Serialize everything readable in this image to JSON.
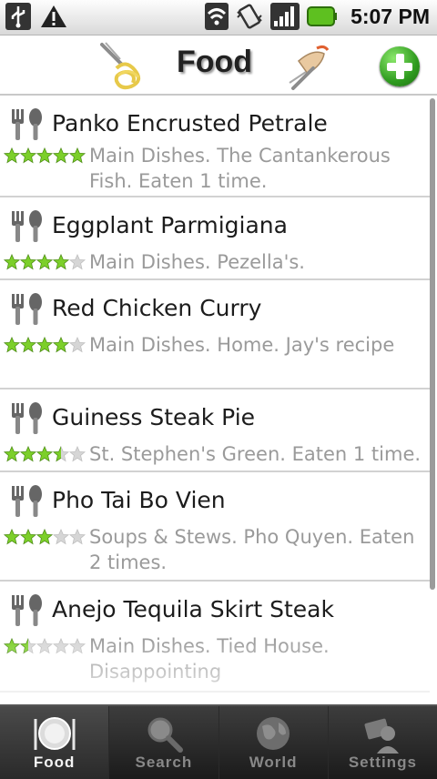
{
  "status_bar": {
    "time": "5:07 PM",
    "icons": [
      "usb-icon",
      "warning-icon",
      "wifi-icon",
      "vibrate-icon",
      "signal-icon",
      "battery-icon"
    ],
    "battery_color": "#5ec020"
  },
  "header": {
    "title": "Food",
    "add_icon": "plus-icon",
    "accent": "#2f9b1f"
  },
  "list": {
    "items": [
      {
        "title": "Panko Encrusted Petrale",
        "rating": 5,
        "description": "Main Dishes. The Cantankerous Fish. Eaten 1 time.",
        "icon": "fork-spoon-icon"
      },
      {
        "title": "Eggplant Parmigiana",
        "rating": 4,
        "description": "Main Dishes. Pezella's.",
        "icon": "fork-spoon-icon"
      },
      {
        "title": "Red Chicken Curry",
        "rating": 4,
        "description": "Main Dishes. Home. Jay's recipe",
        "icon": "fork-spoon-icon"
      },
      {
        "title": "Guiness Steak Pie",
        "rating": 3.5,
        "description": "St. Stephen's Green. Eaten 1 time.",
        "icon": "fork-spoon-icon"
      },
      {
        "title": "Pho Tai Bo Vien",
        "rating": 3,
        "description": "Soups & Stews. Pho Quyen. Eaten 2 times.",
        "icon": "fork-spoon-icon"
      },
      {
        "title": "Anejo Tequila Skirt Steak",
        "rating": 1.5,
        "description": "Main Dishes. Tied House. Disappointing",
        "icon": "fork-spoon-icon"
      }
    ],
    "star_color": "#7ccf2a",
    "empty_star_color": "#d6d6d6"
  },
  "tabs": [
    {
      "label": "Food",
      "icon": "plate-icon",
      "active": true
    },
    {
      "label": "Search",
      "icon": "magnifier-icon",
      "active": false
    },
    {
      "label": "World",
      "icon": "globe-icon",
      "active": false
    },
    {
      "label": "Settings",
      "icon": "settings-icon",
      "active": false
    }
  ]
}
